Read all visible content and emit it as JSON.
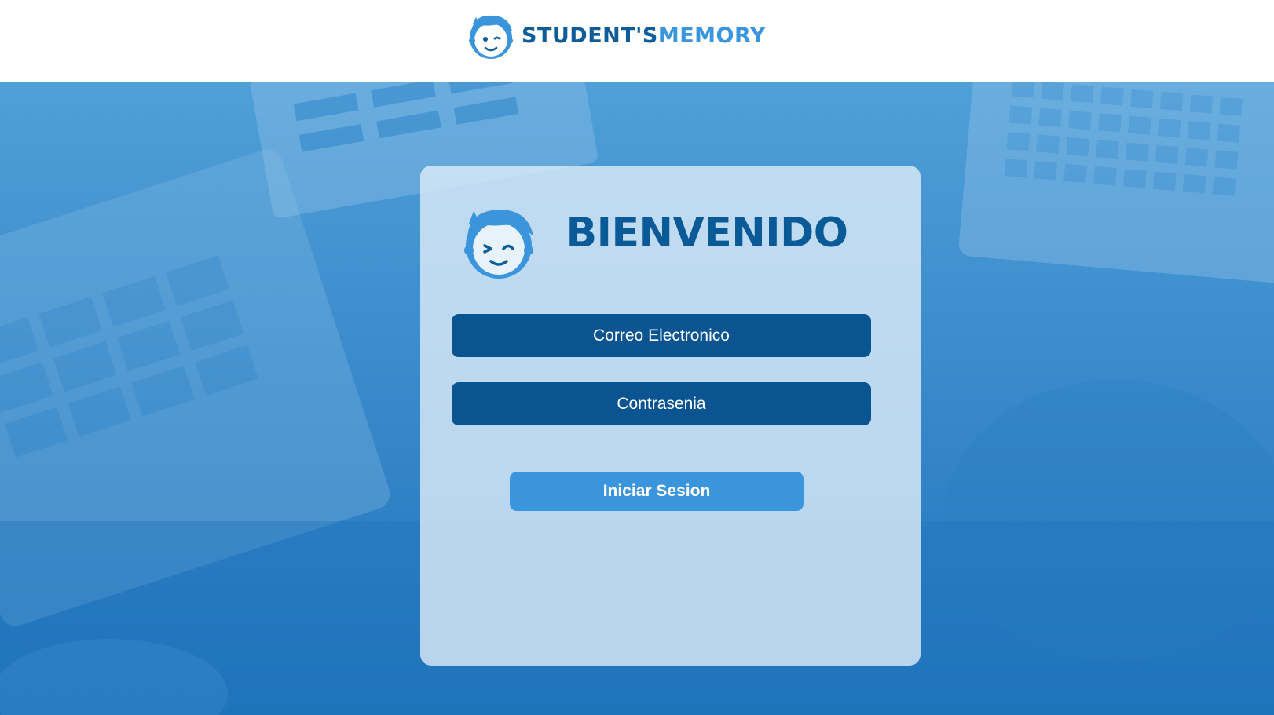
{
  "header": {
    "logo": {
      "text_part1": "STUDENT'S",
      "text_part2": "MEMORY",
      "icon": "boy-face-icon"
    }
  },
  "login_card": {
    "avatar_icon": "boy-face-winking-icon",
    "title": "BIENVENIDO",
    "email_field": {
      "placeholder": "Correo Electronico",
      "value": ""
    },
    "password_field": {
      "placeholder": "Contrasenia",
      "value": ""
    },
    "login_button_label": "Iniciar Sesion"
  },
  "colors": {
    "brand_dark": "#0e5d99",
    "brand_light": "#3a95dc",
    "field_bg": "#0a5591",
    "button_bg": "#3a95dc",
    "title": "#0a5a97"
  }
}
